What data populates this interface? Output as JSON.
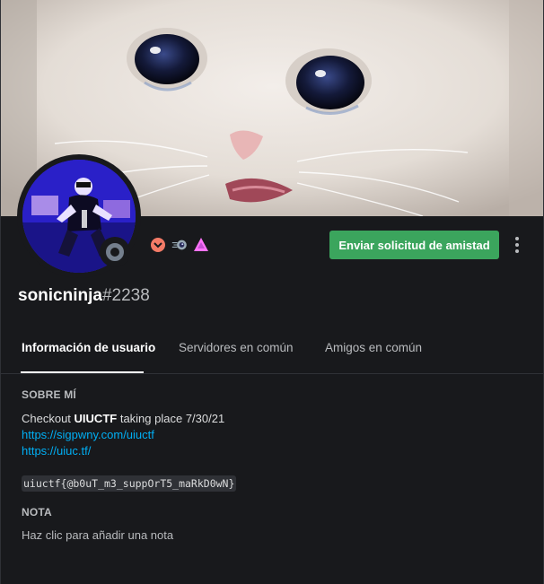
{
  "profile": {
    "username": "sonicninja",
    "discriminator": "#2238",
    "status": "offline",
    "friend_request_button": "Enviar solicitud de amistad"
  },
  "badges": [
    {
      "icon": "nitro-boost-badge-icon",
      "color": "#f47b67"
    },
    {
      "icon": "hypesquad-balance-badge-icon",
      "color": "#99aab5"
    },
    {
      "icon": "server-boost-triangle-icon",
      "color": "#ff73fa"
    }
  ],
  "tabs": [
    {
      "label": "Información de usuario",
      "active": true
    },
    {
      "label": "Servidores en común",
      "active": false
    },
    {
      "label": "Amigos en común",
      "active": false
    }
  ],
  "about": {
    "title": "SOBRE MÍ",
    "line1_prefix": "Checkout ",
    "line1_bold": "UIUCTF",
    "line1_suffix": " taking place 7/30/21",
    "link1": "https://sigpwny.com/uiuctf",
    "link2": "https://uiuc.tf/",
    "code": "uiuctf{@b0uT_m3_suppOrT5_maRkD0wN}"
  },
  "note": {
    "title": "NOTA",
    "placeholder": "Haz clic para añadir una nota"
  },
  "colors": {
    "background": "#18191c",
    "button_green": "#3ba55d",
    "link": "#00aff4",
    "status_offline": "#747f8d"
  }
}
